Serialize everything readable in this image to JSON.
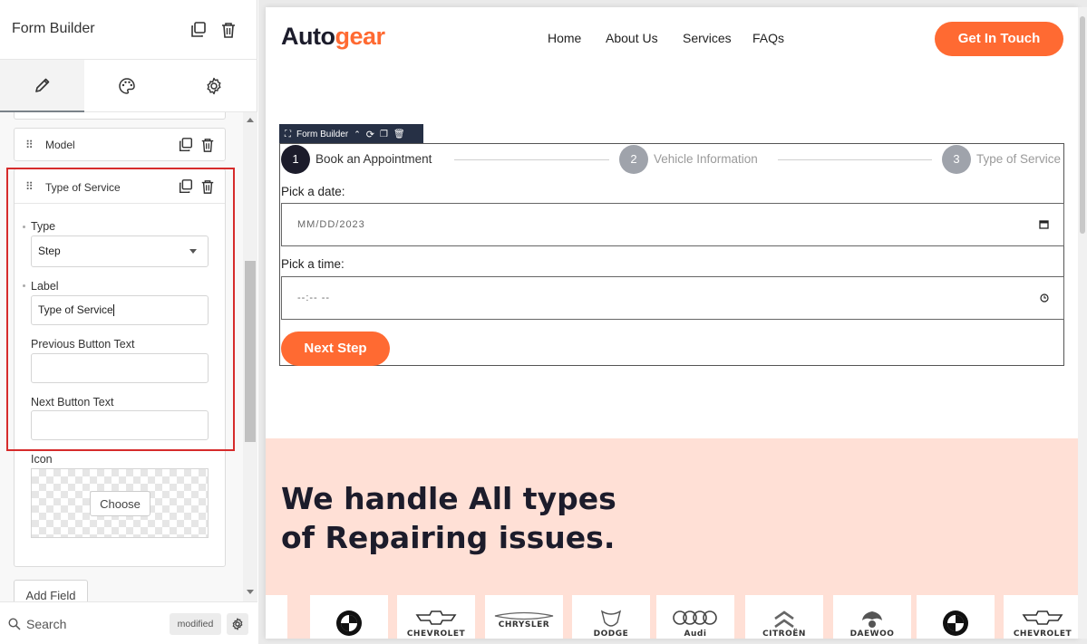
{
  "panel": {
    "title": "Form Builder",
    "tabs": [
      {
        "name": "content",
        "icon": "pencil-icon"
      },
      {
        "name": "style",
        "icon": "palette-icon"
      },
      {
        "name": "advanced",
        "icon": "gear-icon"
      }
    ],
    "fields": {
      "model_label": "Model",
      "service_label": "Type of Service"
    },
    "controls": {
      "type_label": "Type",
      "type_value": "Step",
      "label_label": "Label",
      "label_value": "Type of Service",
      "prev_btn_label": "Previous Button Text",
      "prev_btn_value": "",
      "next_btn_label": "Next Button Text",
      "next_btn_value": "",
      "icon_label": "Icon",
      "choose_label": "Choose"
    },
    "add_field_label": "Add Field",
    "footer": {
      "search_label": "Search",
      "modified_label": "modified"
    }
  },
  "site": {
    "logo_part1": "Auto",
    "logo_part2": "gear",
    "nav": [
      "Home",
      "About Us",
      "Services",
      "FAQs"
    ],
    "cta_label": "Get In Touch",
    "brand_color": "#ff6a32",
    "dark_color": "#1c1c2b"
  },
  "form": {
    "widget_tag": "Form Builder",
    "steps": [
      {
        "number": "1",
        "label": "Book an Appointment",
        "active": true
      },
      {
        "number": "2",
        "label": "Vehicle Information",
        "active": false
      },
      {
        "number": "3",
        "label": "Type of Service",
        "active": false
      }
    ],
    "date_label": "Pick a date:",
    "date_placeholder": "MM/DD/2023",
    "time_label": "Pick a time:",
    "time_placeholder": "--:-- --",
    "next_label": "Next Step"
  },
  "repair": {
    "heading_line1": "We handle All types",
    "heading_line2": "of Repairing issues.",
    "brands": [
      "",
      "",
      "CHEVROLET",
      "CHRYSLER",
      "DODGE",
      "Audi",
      "CITROËN",
      "DAEWOO",
      "",
      "CHEVROLET"
    ]
  }
}
